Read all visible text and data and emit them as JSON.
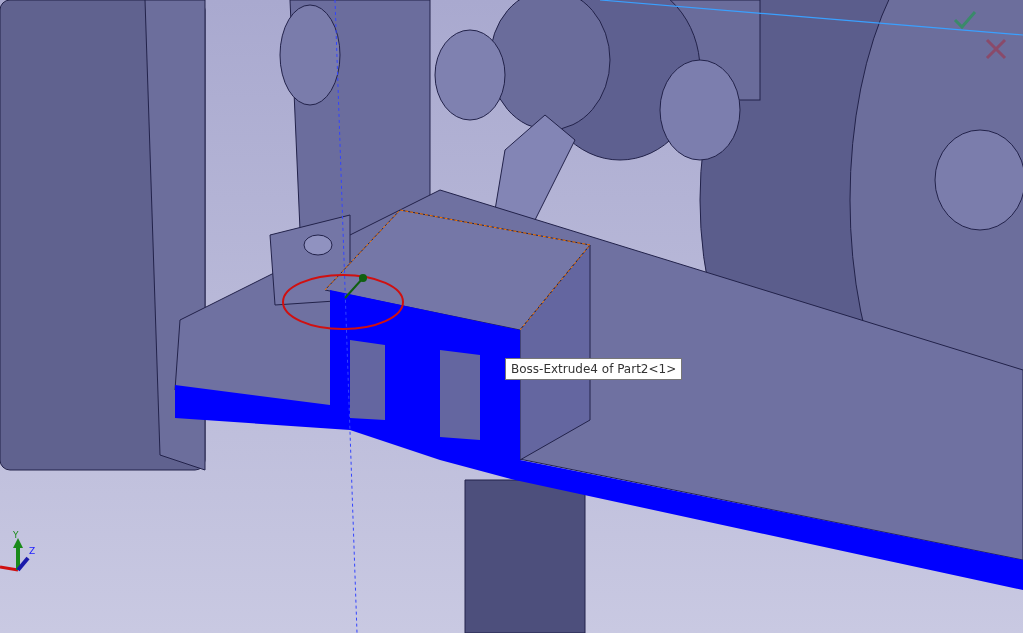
{
  "tooltip": {
    "text": "Boss-Extrude4 of Part2<1>"
  },
  "triad": {
    "y_label": "Y",
    "z_label": "Z"
  }
}
